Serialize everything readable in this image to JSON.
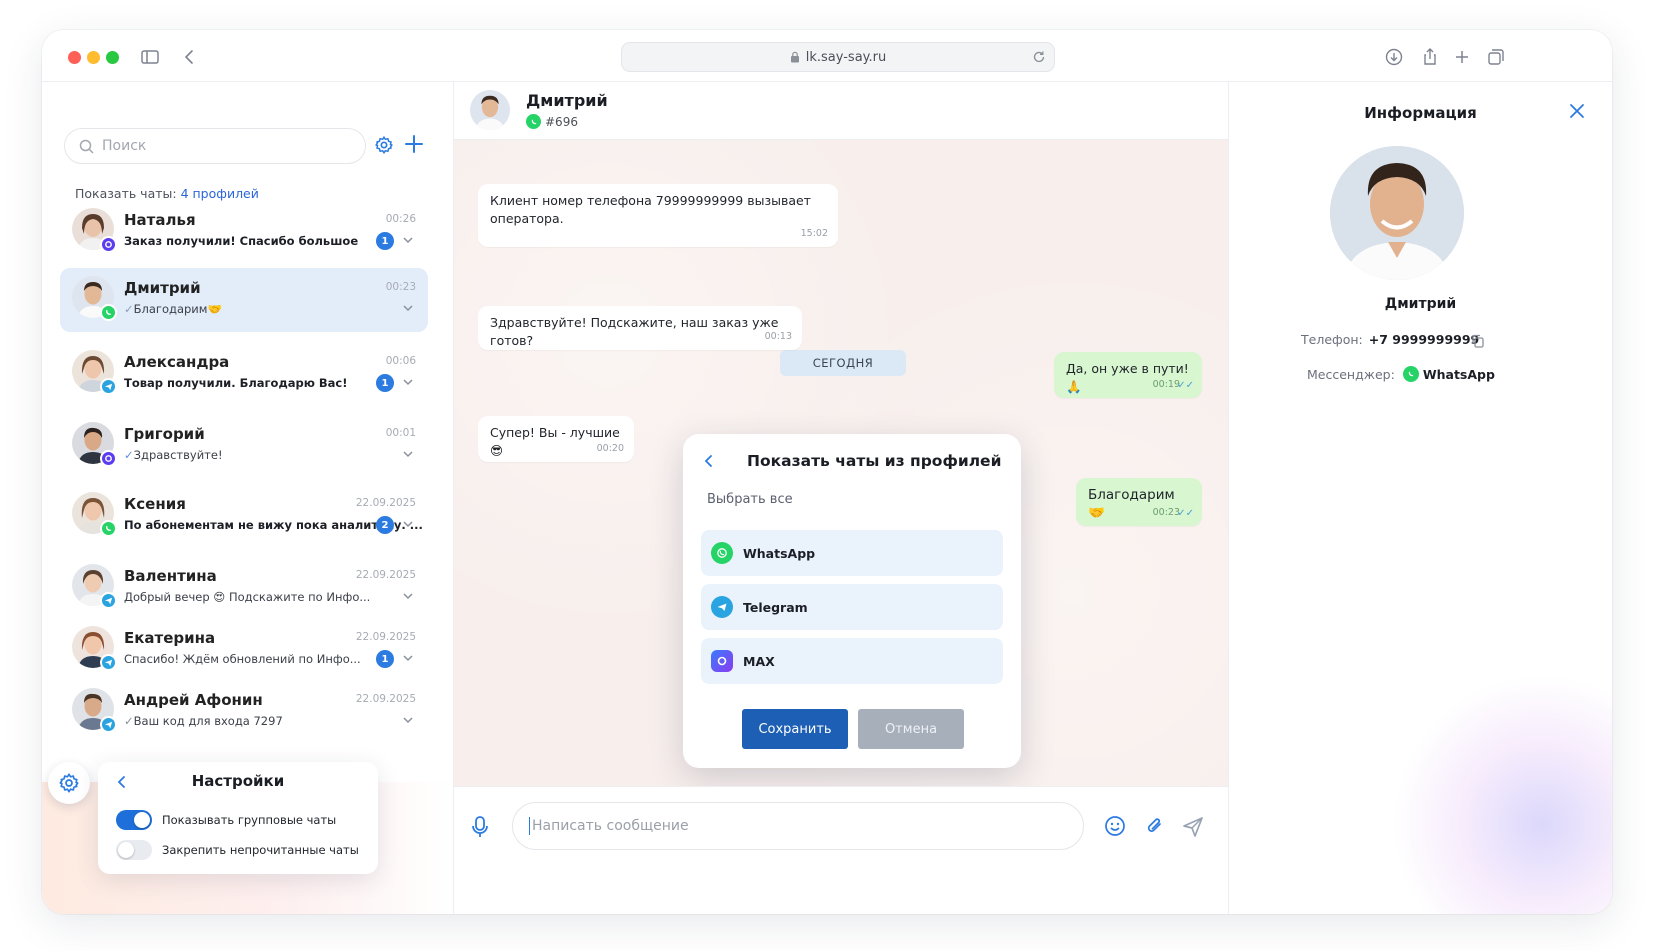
{
  "browser": {
    "url": "lk.say-say.ru"
  },
  "sidebar": {
    "search_placeholder": "Поиск",
    "profiles_label": "Показать чаты:",
    "profiles_link": "4 профилей",
    "chats": [
      {
        "name": "Наталья",
        "preview": "Заказ получили! Спасибо большое",
        "time": "00:26",
        "unread": "1",
        "source": "max"
      },
      {
        "name": "Дмитрий",
        "preview": "Благодарим",
        "time": "00:23",
        "unread": "",
        "source": "whatsapp",
        "active": true
      },
      {
        "name": "Александра",
        "preview": "Товар получили. Благодарю Вас!",
        "time": "00:06",
        "unread": "1",
        "source": "telegram"
      },
      {
        "name": "Григорий",
        "preview": "Здравствуйте!",
        "time": "00:01",
        "unread": "",
        "source": "max"
      },
      {
        "name": "Ксения",
        "preview": "По абонементам не вижу пока аналитику. ...",
        "time": "22.09.2025",
        "unread": "2",
        "source": "whatsapp"
      },
      {
        "name": "Валентина",
        "preview": "Добрый вечер 😍 Подскажите по Инфо...",
        "time": "22.09.2025",
        "unread": "",
        "source": "telegram"
      },
      {
        "name": "Екатерина",
        "preview": "Спасибо! Ждём обновлений по Инфо...",
        "time": "22.09.2025",
        "unread": "1",
        "source": "telegram"
      },
      {
        "name": "Андрей Афонин",
        "preview": "Ваш код для входа 7297",
        "time": "22.09.2025",
        "unread": "",
        "source": "telegram"
      }
    ],
    "settings": {
      "title": "Настройки",
      "toggles": [
        {
          "label": "Показывать групповые чаты",
          "on": true
        },
        {
          "label": "Закрепить непрочитанные чаты",
          "on": false
        }
      ]
    }
  },
  "chat": {
    "contact_name": "Дмитрий",
    "contact_id": "#696",
    "day_separator": "СЕГОДНЯ",
    "messages": [
      {
        "text": "Клиент номер телефона 79999999999 вызывает оператора.",
        "time": "15:02",
        "dir": "in"
      },
      {
        "text": "Здравствуйте! Подскажите, наш заказ уже готов?",
        "time": "00:13",
        "dir": "in"
      },
      {
        "text": "Да, он уже в пути!🙏",
        "time": "00:19",
        "dir": "out"
      },
      {
        "text": "Супер! Вы - лучшие😎",
        "time": "00:20",
        "dir": "in"
      },
      {
        "text": "Благодарим🤝",
        "time": "00:23",
        "dir": "out"
      }
    ],
    "composer_placeholder": "Написать сообщение"
  },
  "modal": {
    "title": "Показать чаты из профилей",
    "select_all": "Выбрать все",
    "options": [
      "WhatsApp",
      "Telegram",
      "MAX"
    ],
    "save": "Сохранить",
    "cancel": "Отмена"
  },
  "info": {
    "title": "Информация",
    "name": "Дмитрий",
    "phone_label": "Телефон:",
    "phone": "+7 9999999999",
    "messenger_label": "Мессенджер:",
    "messenger": "WhatsApp"
  },
  "colors": {
    "accent": "#2c7be0",
    "whatsapp": "#25d366",
    "telegram": "#2aa3e1",
    "max": "#5b3cf0",
    "out_bubble": "#d8f6cf"
  }
}
